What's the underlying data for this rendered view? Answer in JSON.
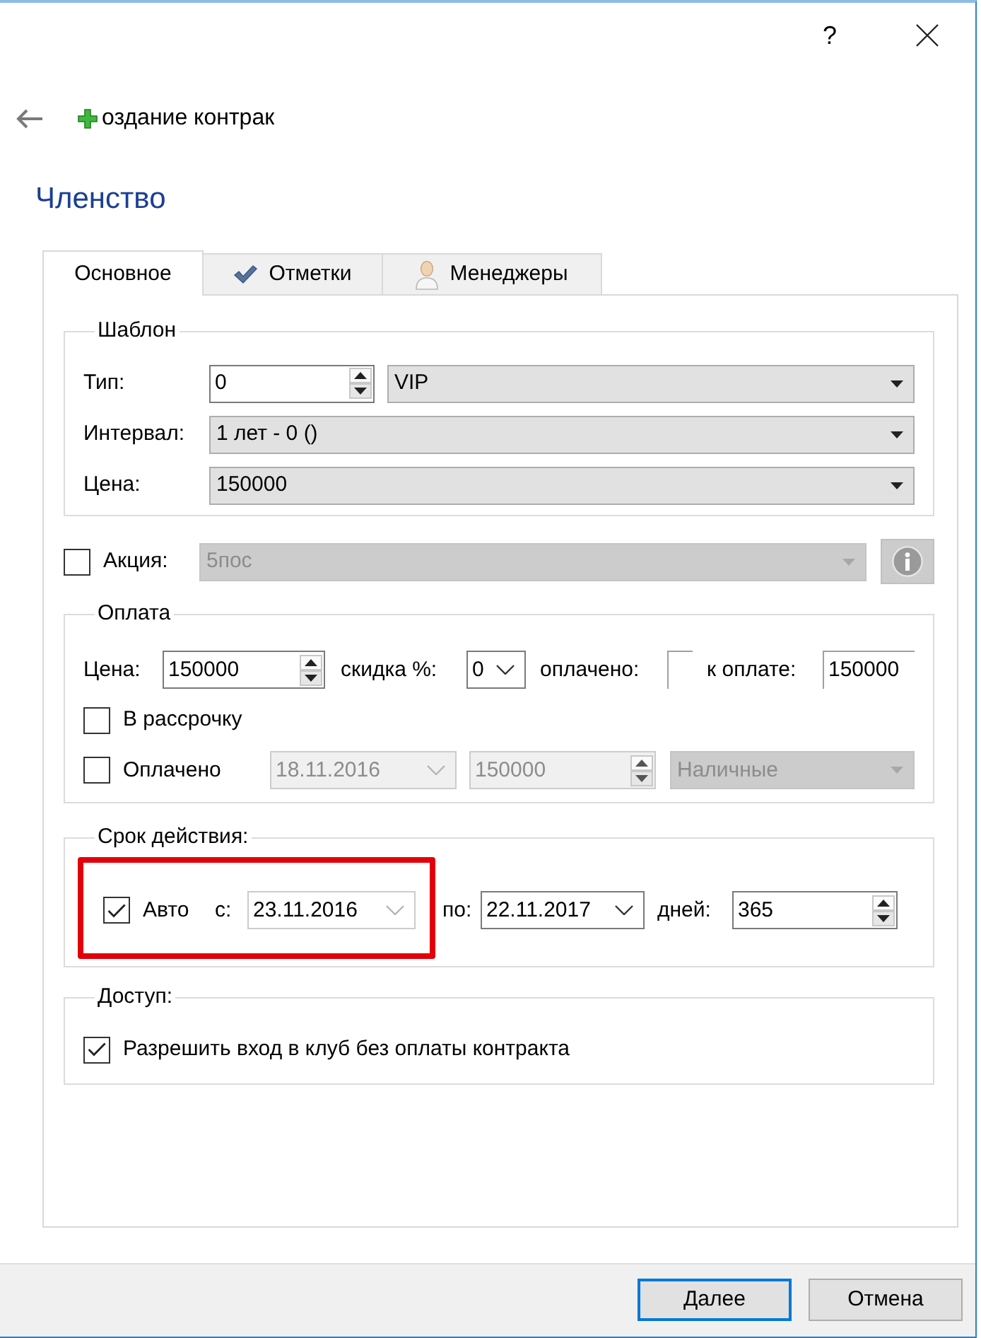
{
  "window": {
    "help_button": "?"
  },
  "header": {
    "title": "оздание контрак"
  },
  "section_title": "Членство",
  "tabs": [
    {
      "label": "Основное",
      "selected": true
    },
    {
      "label": "Отметки",
      "selected": false
    },
    {
      "label": "Менеджеры",
      "selected": false
    }
  ],
  "template": {
    "title": "Шаблон",
    "rows": [
      {
        "kind": "spin_combo",
        "label": "Тип:",
        "value": "0",
        "option": "VIP"
      },
      {
        "kind": "combo",
        "label": "Интервал:",
        "value": "1 лет - 0 ()"
      },
      {
        "kind": "combo",
        "label": "Цена:",
        "value": "150000"
      }
    ]
  },
  "promo": {
    "checked": false,
    "label": "Акция:",
    "value": "5пос",
    "disabled": true
  },
  "payment": {
    "title": "Оплата",
    "price_label": "Цена:",
    "price": "150000",
    "discount_label": "скидка %:",
    "discount": "0",
    "paid_label": "оплачено:",
    "due_label": "к оплате:",
    "due": "150000",
    "installments": {
      "label": "В рассрочку",
      "checked": false
    },
    "paid": {
      "label": "Оплачено",
      "checked": false,
      "disabled": true,
      "date": "18.11.2016",
      "amount": "150000",
      "method": "Наличные"
    }
  },
  "validity": {
    "title": "Срок действия:",
    "auto": {
      "label": "Авто",
      "checked": true
    },
    "from_label": "с:",
    "from": "23.11.2016",
    "from_disabled": true,
    "to_label": "по:",
    "to": "22.11.2017",
    "days_label": "дней:",
    "days": "365"
  },
  "access": {
    "title": "Доступ:",
    "allow_entry": {
      "label": "Разрешить вход в клуб без оплаты контракта",
      "checked": true
    }
  },
  "buttons": [
    {
      "label": "Далее",
      "default": true
    },
    {
      "label": "Отмена",
      "default": false
    }
  ]
}
